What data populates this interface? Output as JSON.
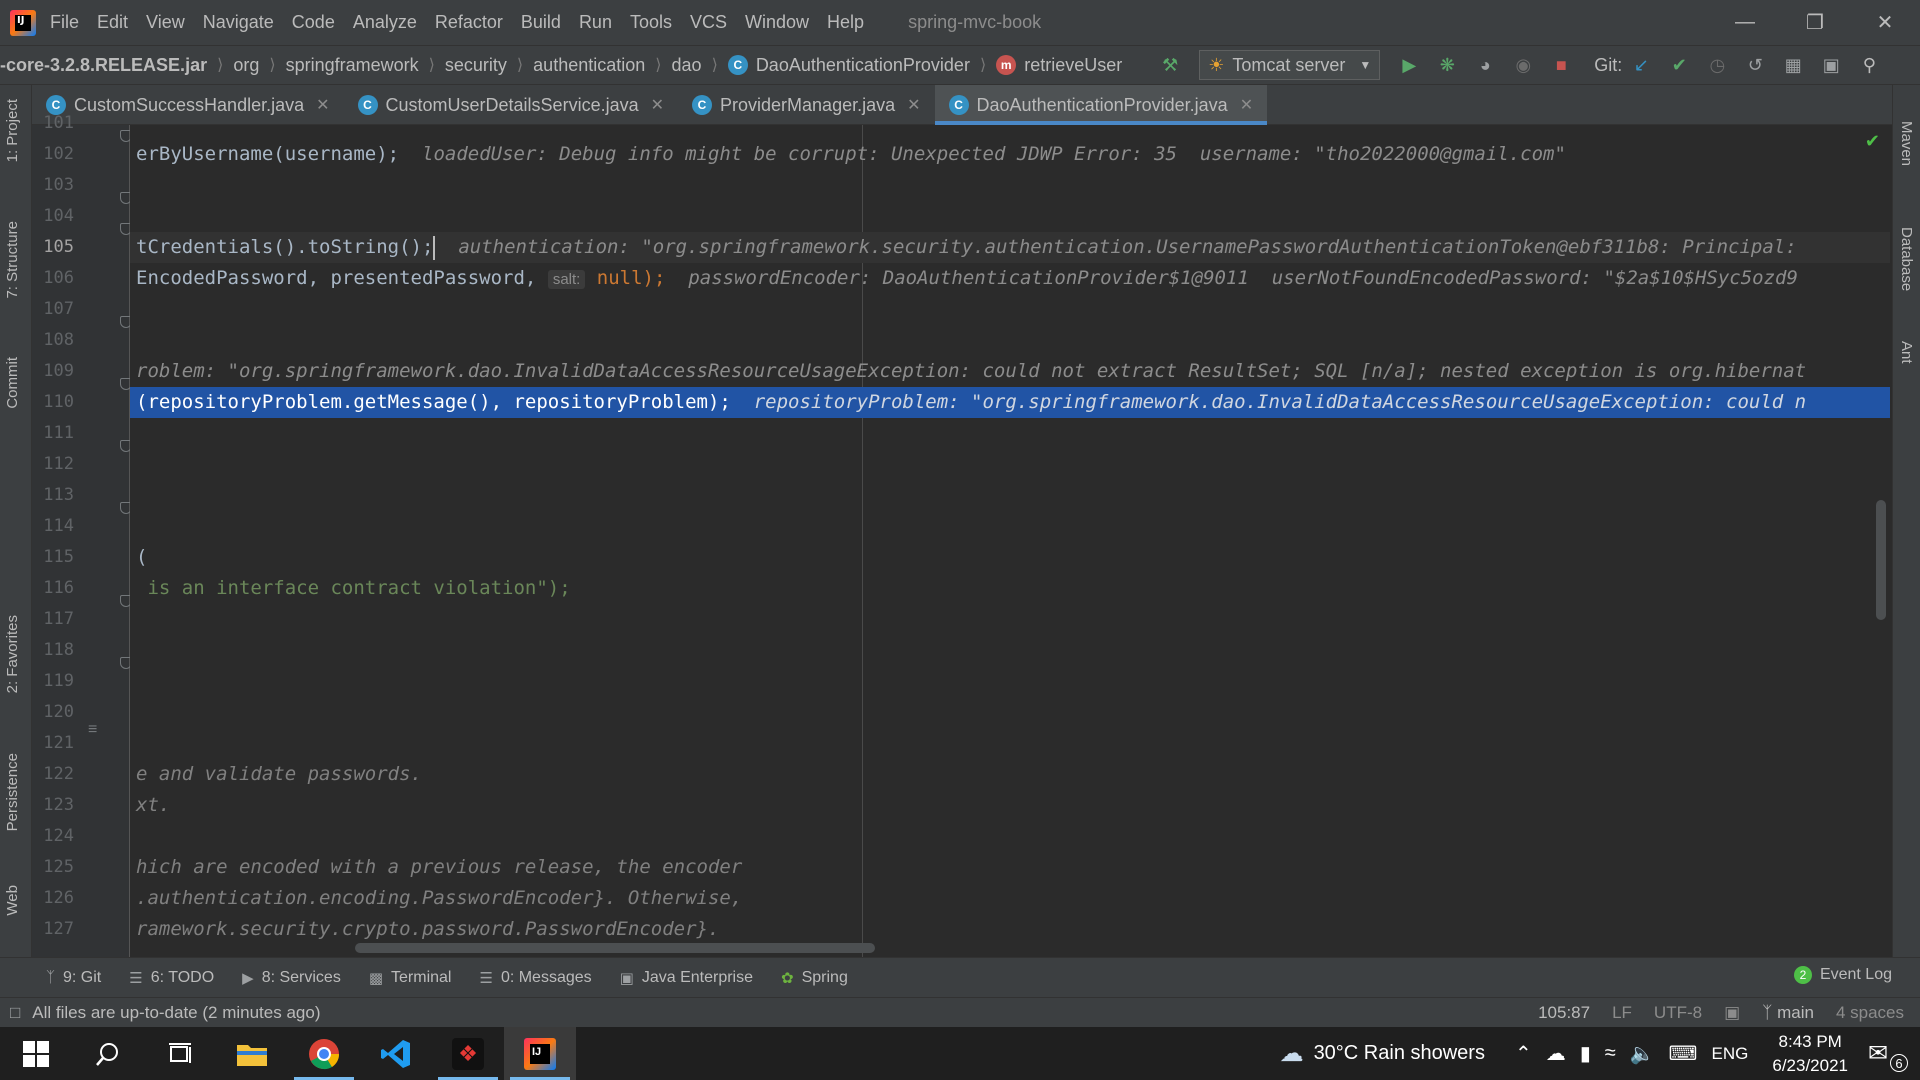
{
  "menubar": {
    "items": [
      {
        "label": "File"
      },
      {
        "label": "Edit"
      },
      {
        "label": "View"
      },
      {
        "label": "Navigate"
      },
      {
        "label": "Code"
      },
      {
        "label": "Analyze"
      },
      {
        "label": "Refactor"
      },
      {
        "label": "Build"
      },
      {
        "label": "Run"
      },
      {
        "label": "Tools"
      },
      {
        "label": "VCS"
      },
      {
        "label": "Window"
      },
      {
        "label": "Help"
      }
    ],
    "project_title": "spring-mvc-book"
  },
  "navbar": {
    "crumbs": [
      "-core-3.2.8.RELEASE.jar",
      "org",
      "springframework",
      "security",
      "authentication",
      "dao",
      "DaoAuthenticationProvider",
      "retrieveUser"
    ],
    "run_config": "Tomcat server",
    "git_label": "Git:"
  },
  "left_tabs": [
    "1: Project",
    "7: Structure",
    "Commit",
    "2: Favorites",
    "Persistence",
    "Web"
  ],
  "right_tabs": [
    "Maven",
    "Database",
    "Ant"
  ],
  "tabs": [
    {
      "label": "CustomSuccessHandler.java"
    },
    {
      "label": "CustomUserDetailsService.java"
    },
    {
      "label": "ProviderManager.java"
    },
    {
      "label": "DaoAuthenticationProvider.java"
    }
  ],
  "editor": {
    "line_numbers": [
      "101",
      "102",
      "103",
      "104",
      "105",
      "106",
      "107",
      "108",
      "109",
      "110",
      "111",
      "112",
      "113",
      "114",
      "115",
      "116",
      "117",
      "118",
      "119",
      "120",
      "121",
      "122",
      "123",
      "124",
      "125",
      "126",
      "127"
    ],
    "l102_code": "erByUsername(username);",
    "l102_debug": "loadedUser: Debug info might be corrupt: Unexpected JDWP Error: 35  username: \"tho2022000@gmail.com\"",
    "l105_code": "tCredentials().toString();",
    "l105_debug": "authentication: \"org.springframework.security.authentication.UsernamePasswordAuthenticationToken@ebf311b8: Principal:",
    "l106_code_a": "EncodedPassword, presentedPassword,",
    "l106_hint": "salt:",
    "l106_code_b": "null);",
    "l106_debug": "passwordEncoder: DaoAuthenticationProvider$1@9011  userNotFoundEncodedPassword: \"$2a$10$HSyc5ozd9",
    "l109_debug": "roblem: \"org.springframework.dao.InvalidDataAccessResourceUsageException: could not extract ResultSet; SQL [n/a]; nested exception is org.hibernat",
    "l110_code": "(repositoryProblem.getMessage(), repositoryProblem);",
    "l110_debug": "repositoryProblem: \"org.springframework.dao.InvalidDataAccessResourceUsageException: could n",
    "l114_code": "(",
    "l115_code": " is an interface contract violation\");",
    "l121_code": "e and validate passwords.",
    "l122_code": "xt.",
    "l124_code": "hich are encoded with a previous release, the encoder",
    "l125_code": ".authentication.encoding.PasswordEncoder}. Otherwise,",
    "l126_code": "ramework.security.crypto.password.PasswordEncoder}."
  },
  "bottom_tools": [
    {
      "label": "9: Git"
    },
    {
      "label": "6: TODO"
    },
    {
      "label": "8: Services"
    },
    {
      "label": "Terminal"
    },
    {
      "label": "0: Messages"
    },
    {
      "label": "Java Enterprise"
    },
    {
      "label": "Spring"
    }
  ],
  "event_log": {
    "count": "2",
    "label": "Event Log"
  },
  "status": {
    "message": "All files are up-to-date (2 minutes ago)",
    "position": "105:87",
    "line_sep": "LF",
    "encoding": "UTF-8",
    "branch": "main",
    "indent": "4 spaces"
  },
  "taskbar": {
    "weather": "30°C  Rain showers",
    "lang": "ENG",
    "time": "8:43 PM",
    "date": "6/23/2021",
    "notif_count": "6"
  }
}
